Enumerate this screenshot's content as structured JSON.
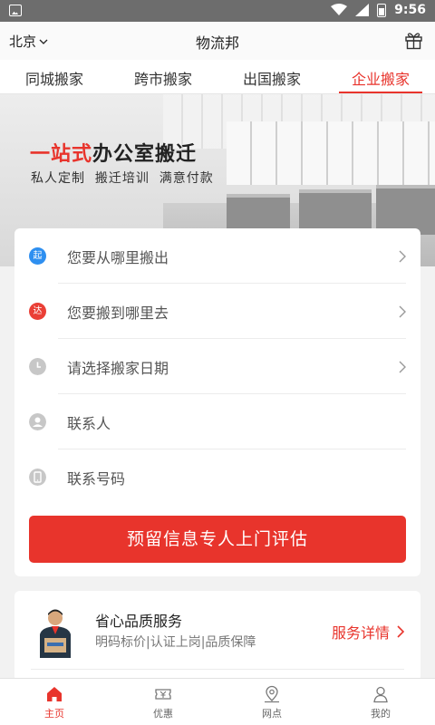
{
  "status_bar": {
    "time": "9:56"
  },
  "header": {
    "city": "北京",
    "title": "物流邦"
  },
  "tabs": [
    {
      "label": "同城搬家",
      "active": false
    },
    {
      "label": "跨市搬家",
      "active": false
    },
    {
      "label": "出国搬家",
      "active": false
    },
    {
      "label": "企业搬家",
      "active": true
    }
  ],
  "banner": {
    "headline_highlight": "一站式",
    "headline_rest": "办公室搬迁",
    "subtitle": "私人定制  搬迁培训  满意付款"
  },
  "form": {
    "rows": [
      {
        "icon": "起",
        "label": "您要从哪里搬出",
        "has_arrow": true
      },
      {
        "icon": "达",
        "label": "您要搬到哪里去",
        "has_arrow": true
      },
      {
        "icon": "clock-icon",
        "label": "请选择搬家日期",
        "has_arrow": true
      },
      {
        "icon": "person-icon",
        "label": "联系人",
        "has_arrow": false
      },
      {
        "icon": "phone-icon",
        "label": "联系号码",
        "has_arrow": false
      }
    ],
    "submit_label": "预留信息专人上门评估"
  },
  "service": {
    "title": "省心品质服务",
    "subtitle": "明码标价|认证上岗|品质保障",
    "link_label": "服务详情"
  },
  "bottom_nav": [
    {
      "label": "主页",
      "icon": "home-icon",
      "active": true
    },
    {
      "label": "优惠",
      "icon": "ticket-icon",
      "active": false
    },
    {
      "label": "网点",
      "icon": "map-pin-icon",
      "active": false
    },
    {
      "label": "我的",
      "icon": "user-icon",
      "active": false
    }
  ],
  "colors": {
    "accent": "#e8342c",
    "start_badge": "#2e8ff0",
    "end_badge": "#ea3f36"
  }
}
